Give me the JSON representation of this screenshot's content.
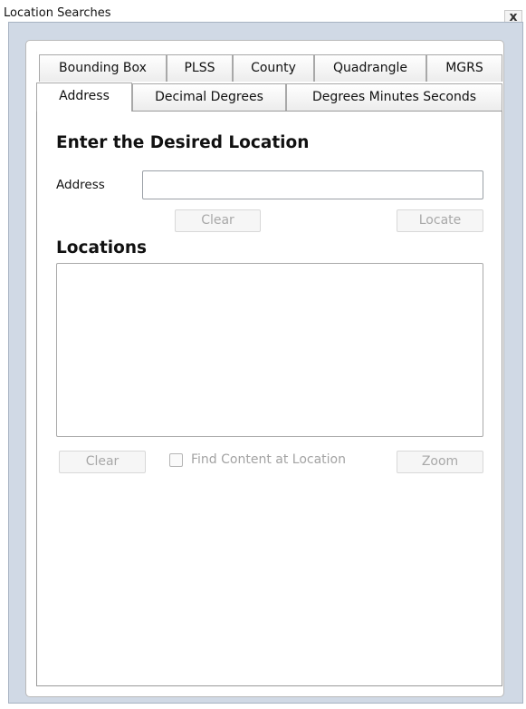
{
  "window": {
    "title": "Location Searches",
    "close_glyph": "x",
    "close_icon": "close-icon"
  },
  "tabs": {
    "row_back": [
      "Bounding Box",
      "PLSS",
      "County",
      "Quadrangle",
      "MGRS"
    ],
    "row_front": [
      "Address",
      "Decimal Degrees",
      "Degrees Minutes Seconds"
    ],
    "active": "Address"
  },
  "address_panel": {
    "heading": "Enter the Desired Location",
    "address_label": "Address",
    "address_value": "",
    "clear_label": "Clear",
    "locate_label": "Locate"
  },
  "locations": {
    "heading": "Locations",
    "items": [],
    "clear_label": "Clear",
    "find_content_label": "Find Content at Location",
    "find_content_checked": false,
    "zoom_label": "Zoom"
  }
}
